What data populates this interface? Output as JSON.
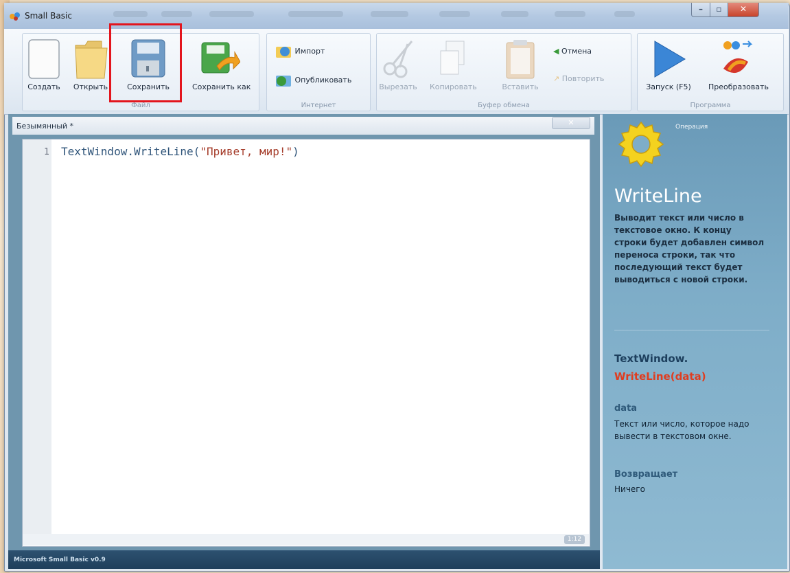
{
  "window": {
    "title": "Small Basic"
  },
  "ribbon": {
    "file": {
      "label": "Файл",
      "new": "Создать",
      "open": "Открыть",
      "save": "Сохранить",
      "save_as": "Сохранить как"
    },
    "internet": {
      "label": "Интернет",
      "import": "Импорт",
      "publish": "Опубликовать"
    },
    "clipboard": {
      "label": "Буфер обмена",
      "cut": "Вырезать",
      "copy": "Копировать",
      "paste": "Вставить",
      "undo": "Отмена",
      "redo": "Повторить"
    },
    "program": {
      "label": "Программа",
      "run": "Запуск (F5)",
      "convert": "Преобразовать"
    }
  },
  "document": {
    "title": "Безымянный *",
    "line_number": "1",
    "code": {
      "object": "TextWindow",
      "dot": ".",
      "method": "WriteLine",
      "open": "(",
      "string": "\"Привет, мир!\"",
      "close": ")"
    },
    "zoom": "1:12"
  },
  "status": {
    "text": "Microsoft Small Basic v0.9"
  },
  "help": {
    "section": "Операция",
    "title": "WriteLine",
    "description": "Выводит текст или число в текстовое окно. К концу строки будет добавлен символ переноса строки, так что последующий текст будет выводиться с новой строки.",
    "class_name": "TextWindow.",
    "signature": "WriteLine(data)",
    "param_name": "data",
    "param_desc": "Текст или число, которое надо вывести в текстовом окне.",
    "returns_heading": "Возвращает",
    "returns_value": "Ничего"
  },
  "colors": {
    "highlight": "#e3151d",
    "signature": "#e03c1f",
    "help_panel": "#7eadc8"
  }
}
